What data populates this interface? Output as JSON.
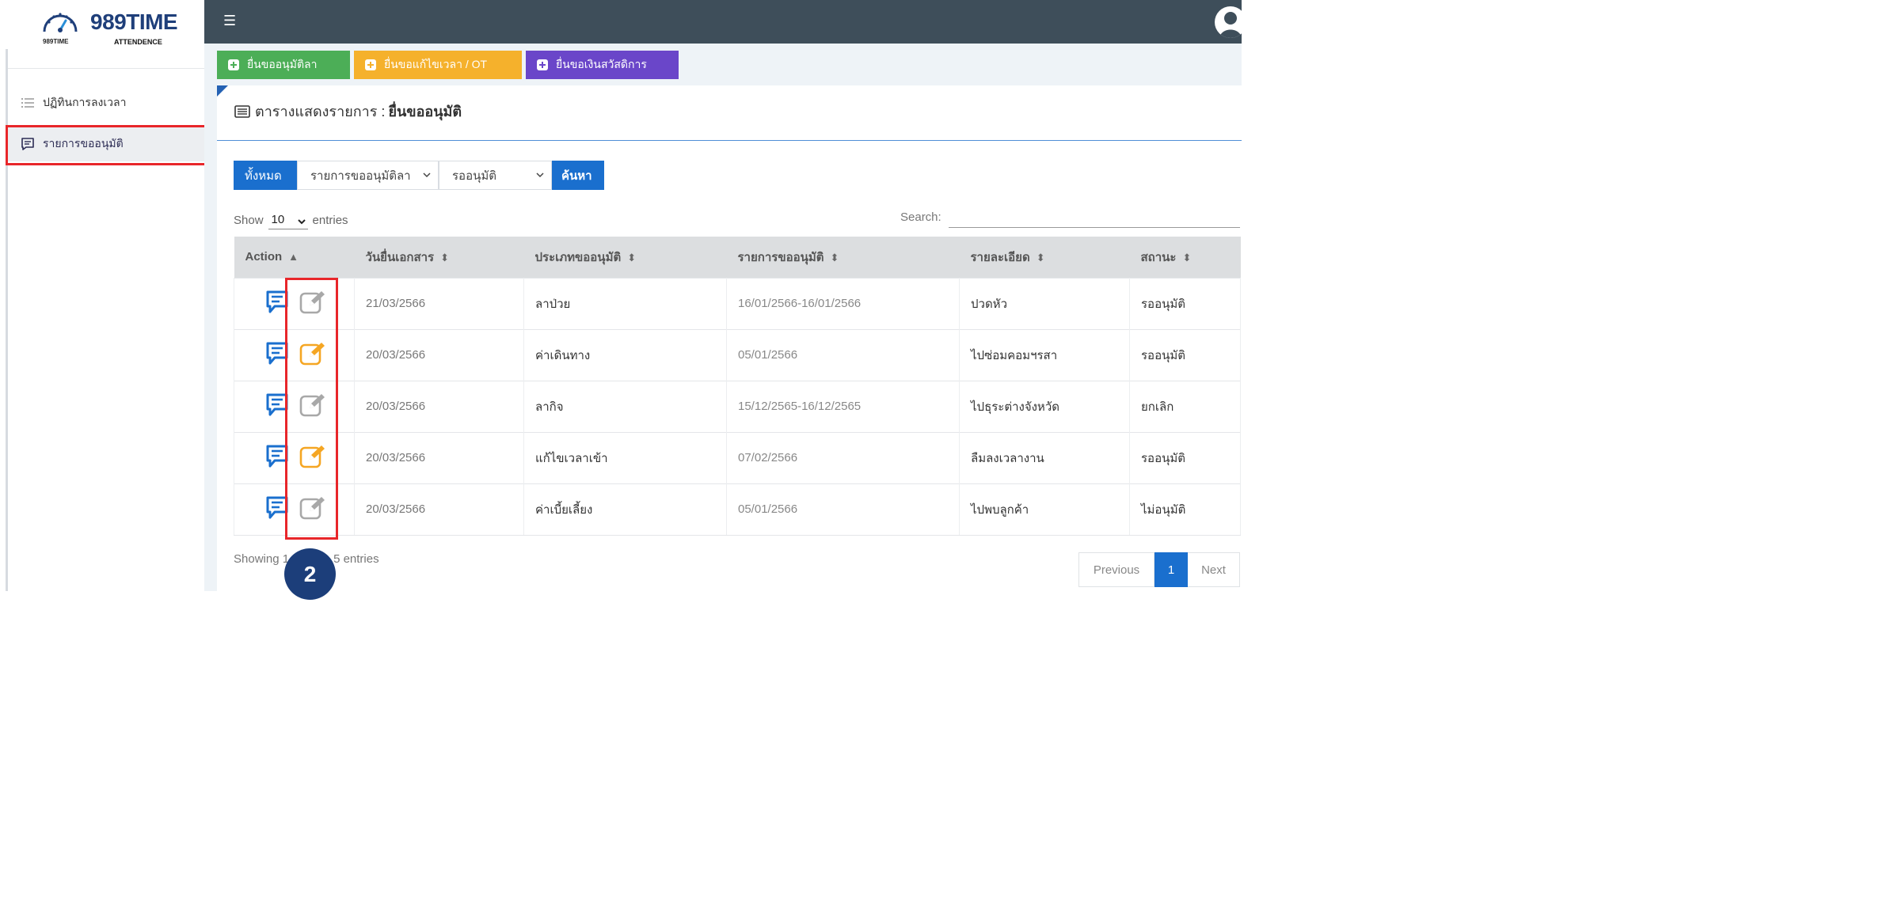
{
  "brand": {
    "name": "989TIME",
    "subtitle": "ATTENDENCE",
    "small_label": "989TIME"
  },
  "sidebar": {
    "items": [
      {
        "label": "ปฏิทินการลงเวลา",
        "icon": "list-icon"
      },
      {
        "label": "รายการขออนุมัติ",
        "icon": "message-icon",
        "active": true
      }
    ]
  },
  "actions": {
    "leave": "ยื่นขออนุมัติลา",
    "time_ot": "ยื่นขอแก้ไขเวลา / OT",
    "welfare": "ยื่นขอเงินสวัสดิการ"
  },
  "page": {
    "title_prefix": "ตารางแสดงรายการ :",
    "title_bold": "ยื่นขออนุมัติ"
  },
  "filters": {
    "all": "ทั้งหมด",
    "type_selected": "รายการขออนุมัติลา",
    "status_selected": "รออนุมัติ",
    "search_button": "ค้นหา"
  },
  "table_controls": {
    "show": "Show",
    "length": "10",
    "entries": "entries",
    "search_label": "Search:",
    "search_value": ""
  },
  "table": {
    "headers": [
      "Action",
      "วันยื่นเอกสาร",
      "ประเภทขออนุมัติ",
      "รายการขออนุมัติ",
      "รายละเอียด",
      "สถานะ"
    ],
    "rows": [
      {
        "date": "21/03/2566",
        "type": "ลาป่วย",
        "period": "16/01/2566-16/01/2566",
        "detail": "ปวดหัว",
        "status": "รออนุมัติ",
        "editable": false
      },
      {
        "date": "20/03/2566",
        "type": "ค่าเดินทาง",
        "period": "05/01/2566",
        "detail": "ไปซ่อมคอมฯรสา",
        "status": "รออนุมัติ",
        "editable": true
      },
      {
        "date": "20/03/2566",
        "type": "ลากิจ",
        "period": "15/12/2565-16/12/2565",
        "detail": "ไปธุระต่างจังหวัด",
        "status": "ยกเลิก",
        "editable": false
      },
      {
        "date": "20/03/2566",
        "type": "แก้ไขเวลาเข้า",
        "period": "07/02/2566",
        "detail": "ลืมลงเวลางาน",
        "status": "รออนุมัติ",
        "editable": true
      },
      {
        "date": "20/03/2566",
        "type": "ค่าเบี้ยเลี้ยง",
        "period": "05/01/2566",
        "detail": "ไปพบลูกค้า",
        "status": "ไม่อนุมัติ",
        "editable": false
      }
    ]
  },
  "footer": {
    "showing_start": "Showing 1",
    "showing_end": "5 entries",
    "badge": "2"
  },
  "pagination": {
    "previous": "Previous",
    "page": "1",
    "next": "Next"
  },
  "colors": {
    "topbar": "#3e4e5a",
    "leave_button": "#4cae57",
    "time_button": "#f5b12c",
    "welfare_button": "#6a46c9",
    "primary": "#1a6fce",
    "highlight": "#e8262a",
    "edit_active": "#f5a623",
    "edit_inactive": "#a8a8a8",
    "message_icon": "#1a6fce"
  }
}
